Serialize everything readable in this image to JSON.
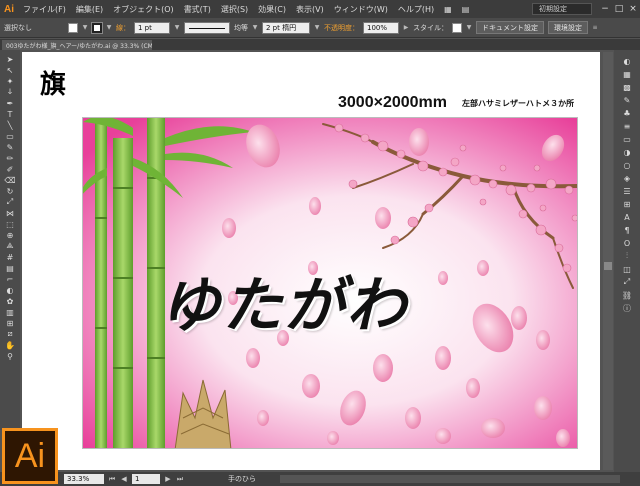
{
  "app": {
    "logo_text": "Ai",
    "accent_color": "#f7931e",
    "menu": [
      "ファイル(F)",
      "編集(E)",
      "オブジェクト(O)",
      "書式(T)",
      "選択(S)",
      "効果(C)",
      "表示(V)",
      "ウィンドウ(W)",
      "ヘルプ(H)"
    ],
    "workspace_label": "初期設定",
    "window_controls": [
      "−",
      "□",
      "×"
    ]
  },
  "control_bar": {
    "selection_label": "選択なし",
    "stroke_label": "線：",
    "stroke_weight": "1 pt",
    "stroke_profile": "均等",
    "brush_label": "2 pt 楕円",
    "opacity_label": "不透明度：",
    "opacity_value": "100%",
    "style_label": "スタイル：",
    "doc_settings_button": "ドキュメント設定",
    "preferences_button": "環境設定"
  },
  "tab": {
    "title": "003ゆたがわ様_旗_ヘアー/ゆたがわ.ai @ 33.3% (CMYK/プレビュー)"
  },
  "canvas": {
    "title": "旗",
    "size_text": "3000×2000mm",
    "note_text": "左部ハサミレザーハトメ３か所",
    "flag_text": "ゆたがわ",
    "colors": {
      "bg_pink": "#e8409a",
      "bamboo_green": "#7cc043",
      "blossom_pink": "#f4a6c6",
      "branch_brown": "#8a5a3a"
    }
  },
  "status_bar": {
    "zoom_value": "33.3%",
    "page_value": "1",
    "tool_label": "手のひら"
  },
  "logo_badge": {
    "text": "Ai"
  }
}
